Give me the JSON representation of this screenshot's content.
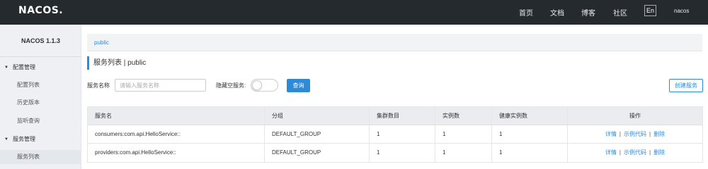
{
  "header": {
    "logo": "NACOS.",
    "nav": [
      "首页",
      "文档",
      "博客",
      "社区"
    ],
    "lang_button": "En",
    "user": "nacos"
  },
  "sidebar": {
    "title": "NACOS 1.1.3",
    "groups": [
      {
        "label": "配置管理",
        "items": [
          "配置列表",
          "历史版本",
          "监听查询"
        ]
      },
      {
        "label": "服务管理",
        "items": [
          "服务列表"
        ]
      }
    ],
    "active_item": "服务列表"
  },
  "breadcrumb": "public",
  "page_title": "服务列表  |  public",
  "filter": {
    "service_name_label": "服务名称",
    "service_name_placeholder": "请输入服务名称",
    "hide_empty_label": "隐藏空服务:",
    "hide_empty_on": false,
    "query_button": "查询",
    "create_button": "创建服务"
  },
  "table": {
    "columns": [
      "服务名",
      "分组",
      "集群数目",
      "实例数",
      "健康实例数",
      "操作"
    ],
    "rows": [
      {
        "name": "consumers:com.api.HelloService::",
        "group": "DEFAULT_GROUP",
        "clusters": "1",
        "instances": "1",
        "healthy": "1"
      },
      {
        "name": "providers:com.api.HelloService::",
        "group": "DEFAULT_GROUP",
        "clusters": "1",
        "instances": "1",
        "healthy": "1"
      }
    ],
    "operations": [
      "详情",
      "示例代码",
      "删除"
    ],
    "op_separator": "|"
  },
  "colors": {
    "topbar": "#252a2f",
    "accent": "#2c8bd8",
    "sidebar": "#eef0f3"
  }
}
